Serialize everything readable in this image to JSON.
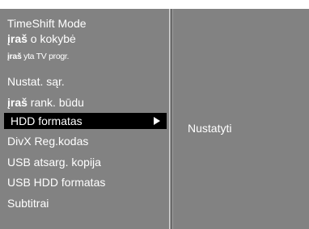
{
  "menu": {
    "items": [
      {
        "label": "TimeShift Mode"
      },
      {
        "parts": [
          "į",
          "raš",
          " o kokybė"
        ]
      },
      {
        "parts": [
          "į",
          "raš",
          " yta TV progr."
        ]
      },
      {
        "label": "Nustat. sąr."
      },
      {
        "parts": [
          "į",
          "raš",
          "  rank. būdu"
        ]
      },
      {
        "label": "HDD formatas",
        "selected": true
      },
      {
        "label": "DivX Reg.kodas"
      },
      {
        "label": "USB atsarg. kopija"
      },
      {
        "label": "USB HDD formatas"
      },
      {
        "label": "Subtitrai"
      }
    ]
  },
  "submenu": {
    "option_label": "Nustatyti"
  },
  "icons": {
    "selected_arrow": "arrow-right-icon"
  },
  "colors": {
    "panel_bg": "#828282",
    "selection_bg": "#000000",
    "text": "#ffffff"
  }
}
